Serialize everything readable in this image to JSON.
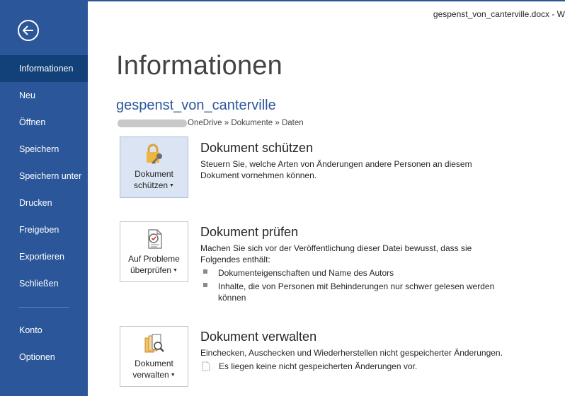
{
  "window": {
    "doc_title": "gespenst_von_canterville.docx - W"
  },
  "sidebar": {
    "back_label": "Zurück",
    "items": [
      {
        "label": "Informationen",
        "active": true
      },
      {
        "label": "Neu"
      },
      {
        "label": "Öffnen"
      },
      {
        "label": "Speichern"
      },
      {
        "label": "Speichern unter"
      },
      {
        "label": "Drucken"
      },
      {
        "label": "Freigeben"
      },
      {
        "label": "Exportieren"
      },
      {
        "label": "Schließen"
      }
    ],
    "bottom_items": [
      {
        "label": "Konto"
      },
      {
        "label": "Optionen"
      }
    ]
  },
  "main": {
    "title": "Informationen",
    "doc_name": "gespenst_von_canterville",
    "path": "OneDrive » Dokumente » Daten",
    "sections": [
      {
        "button_line1": "Dokument",
        "button_line2": "schützen",
        "title": "Dokument schützen",
        "description": "Steuern Sie, welche Arten von Änderungen andere Personen an diesem Dokument vornehmen können."
      },
      {
        "button_line1": "Auf Probleme",
        "button_line2": "überprüfen",
        "title": "Dokument prüfen",
        "description": "Machen Sie sich vor der Veröffentlichung dieser Datei bewusst, dass sie Folgendes enthält:",
        "bullets": [
          "Dokumenteigenschaften und Name des Autors",
          "Inhalte, die von Personen mit Behinderungen nur schwer gelesen werden können"
        ]
      },
      {
        "button_line1": "Dokument",
        "button_line2": "verwalten",
        "title": "Dokument verwalten",
        "description": "Einchecken, Auschecken und Wiederherstellen nicht gespeicherter Änderungen.",
        "note": "Es liegen keine nicht gespeicherten Änderungen vor."
      }
    ]
  },
  "colors": {
    "accent": "#2b579a",
    "active_nav": "#124078",
    "selected_button": "#dae4f2"
  }
}
